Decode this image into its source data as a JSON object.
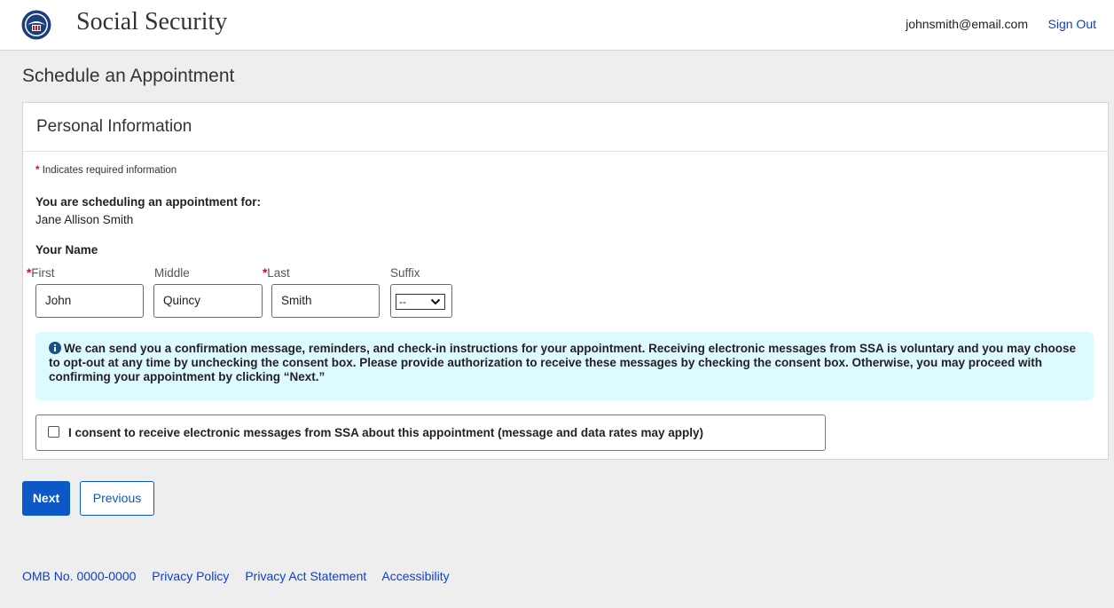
{
  "header": {
    "brand": "Social Security",
    "user_email": "johnsmith@email.com",
    "sign_out": "Sign Out"
  },
  "page": {
    "title": "Schedule an Appointment"
  },
  "card": {
    "title": "Personal Information",
    "required_note": "Indicates required information",
    "scheduling_label": "You are scheduling an appointment for:",
    "scheduling_name": "Jane Allison Smith",
    "your_name_label": "Your Name",
    "fields": {
      "first": {
        "label": "First",
        "value": "John",
        "required": true
      },
      "middle": {
        "label": "Middle",
        "value": "Quincy",
        "required": false
      },
      "last": {
        "label": "Last",
        "value": "Smith",
        "required": true
      },
      "suffix": {
        "label": "Suffix",
        "value": "--"
      }
    },
    "info_message": "We can send you a confirmation message, reminders, and check-in instructions for your appointment. Receiving electronic messages from SSA is voluntary and you may choose to opt-out at any time by unchecking the consent box. Please provide authorization to receive these messages by checking the consent box.  Otherwise, you may proceed with confirming your appointment by clicking “Next.”",
    "consent_label": "I consent to receive electronic messages from SSA about this appointment (message and data rates may apply)",
    "consent_checked": false
  },
  "buttons": {
    "next": "Next",
    "previous": "Previous"
  },
  "footer": {
    "links": [
      "OMB No. 0000-0000",
      "Privacy Policy",
      "Privacy Act Statement",
      "Accessibility"
    ]
  },
  "colors": {
    "primary": "#0b58c6",
    "link": "#0b3fd1",
    "required": "#c8102e",
    "info_bg": "#dcfaff",
    "page_bg": "#eeeeee"
  },
  "icons": {
    "logo": "ssa-seal-icon",
    "info": "info-circle-icon",
    "dropdown": "chevron-down-icon"
  }
}
